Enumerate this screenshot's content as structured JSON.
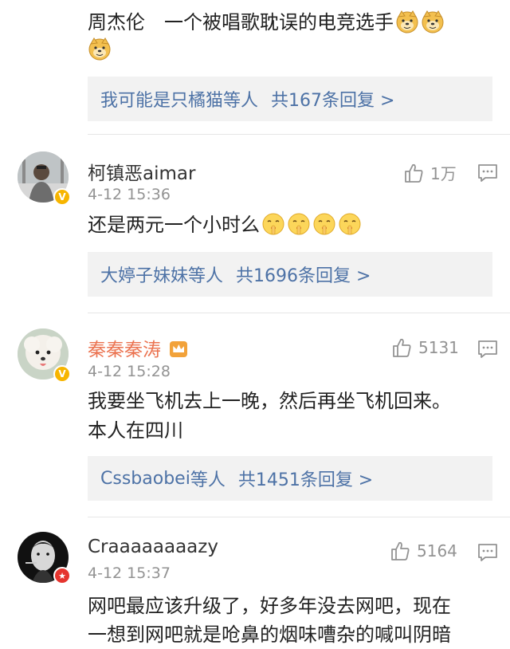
{
  "comments": [
    {
      "text": "周杰伦　一个被唱歌耽误的电竞选手",
      "replies": {
        "who": "我可能是只橘猫",
        "others": "等人",
        "count": "共167条回复 >"
      }
    },
    {
      "name": "柯镇恶aimar",
      "time": "4-12 15:36",
      "likes": "1万",
      "text": "还是两元一个小时么",
      "replies": {
        "who": "大婷子妹妹",
        "others": "等人",
        "count": "共1696条回复 >"
      }
    },
    {
      "name": "秦秦秦涛",
      "time": "4-12 15:28",
      "likes": "5131",
      "text_line1": "我要坐飞机去上一晚，然后再坐飞机回来。",
      "text_line2": "本人在四川",
      "replies": {
        "who": "Cssbaobei",
        "others": "等人",
        "count": "共1451条回复 >"
      }
    },
    {
      "name": "Craaaaaaaazy",
      "time": "4-12 15:37",
      "likes": "5164",
      "text_line1": "网吧最应该升级了，好多年没去网吧，现在",
      "text_line2": "一想到网吧就是呛鼻的烟味嘈杂的喊叫阴暗"
    }
  ],
  "icons": {
    "like": "thumbs-up-icon",
    "comment": "comment-bubble-icon",
    "verified": "verified-v-icon",
    "star": "star-badge-icon"
  },
  "colors": {
    "link": "#4d72a6",
    "meta": "#939393",
    "vip_name": "#eb7350",
    "reply_bg": "#f2f2f2"
  }
}
